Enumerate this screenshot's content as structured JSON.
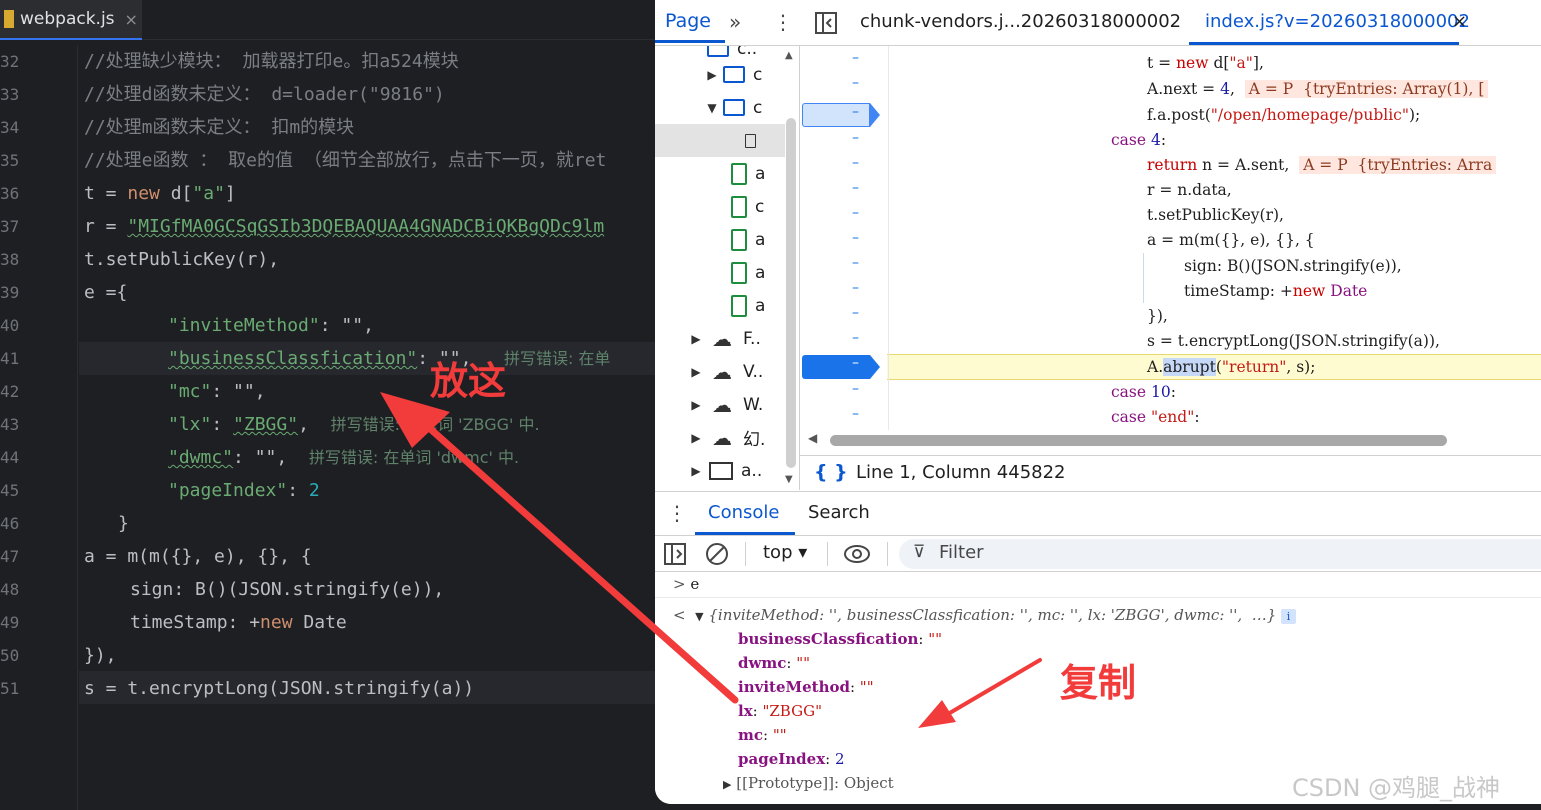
{
  "ide": {
    "tab": {
      "filename": "webpack.js",
      "close": "×"
    },
    "line_numbers": [
      "32",
      "33",
      "34",
      "35",
      "36",
      "37",
      "38",
      "39",
      "40",
      "41",
      "42",
      "43",
      "44",
      "45",
      "46",
      "47",
      "48",
      "49",
      "50",
      "51"
    ],
    "lines": {
      "l32": "//处理缺少模块： 加载器打印e。扣a524模块",
      "l33": "//处理d函数未定义： d=loader(\"9816\")",
      "l34": "//处理m函数未定义： 扣m的模块",
      "l35": "//处理e函数 ： 取e的值 （细节全部放行，点击下一页，就ret",
      "l36_a": "t = ",
      "l36_kw": "new",
      "l36_b": " d[",
      "l36_str": "\"a\"",
      "l36_c": "]",
      "l37_a": "r = ",
      "l37_str": "\"MIGfMA0GCSqGSIb3DQEBAQUAA4GNADCBiQKBgQDc9lm",
      "l38": "t.setPublicKey(r),",
      "l39": "e ={",
      "l40_k": "\"inviteMethod\"",
      "l40_v": ": \"\",",
      "l41_k": "\"businessClassfication\"",
      "l41_v": ": \"\",",
      "l41_hint": "拼写错误: 在单",
      "l42_k": "\"mc\"",
      "l42_v": ": \"\",",
      "l43_k": "\"lx\"",
      "l43_m": ": ",
      "l43_v": "\"ZBGG\"",
      "l43_e": ",",
      "l43_hint": "拼写错误: 在单词 'ZBGG' 中.",
      "l44_k": "\"dwmc\"",
      "l44_v": ": \"\",",
      "l44_hint": "拼写错误: 在单词 'dwmc' 中.",
      "l45_k": "\"pageIndex\"",
      "l45_m": ": ",
      "l45_v": "2",
      "l46": "}",
      "l47": "a = m(m({}, e), {}, {",
      "l48": "sign: B()(JSON.stringify(e)),",
      "l49_a": "timeStamp: +",
      "l49_kw": "new",
      "l49_b": " Date",
      "l50": "}),",
      "l51": "s = t.encryptLong(JSON.stringify(a))"
    }
  },
  "devtools": {
    "page_tab": "Page",
    "more_tabs_icon": "»",
    "menu_icon": "⋮",
    "file_tabs": [
      "chunk-vendors.j...20260318000002",
      "index.js?v=20260318000002"
    ],
    "file_tab_close": "×",
    "navigator": {
      "items": [
        {
          "label": "c..",
          "kind": "folder"
        },
        {
          "label": "c",
          "kind": "folder"
        },
        {
          "label": "c",
          "kind": "folder"
        },
        {
          "label": "",
          "kind": "file-selected"
        },
        {
          "label": "a",
          "kind": "file"
        },
        {
          "label": "c",
          "kind": "file"
        },
        {
          "label": "a",
          "kind": "file"
        },
        {
          "label": "a",
          "kind": "file"
        },
        {
          "label": "a",
          "kind": "file"
        },
        {
          "label": "F..",
          "kind": "cloud"
        },
        {
          "label": "V..",
          "kind": "cloud"
        },
        {
          "label": "W.",
          "kind": "cloud"
        },
        {
          "label": "幻.",
          "kind": "cloud"
        },
        {
          "label": "a..",
          "kind": "frame"
        }
      ]
    },
    "source": {
      "line_marker": "–",
      "l1_a": "t = ",
      "l1_kw": "new",
      "l1_b": " d[",
      "l1_str": "\"a\"",
      "l1_c": "],",
      "l2_a": "A.next = ",
      "l2_num": "4",
      "l2_b": ",",
      "l2_inline": "A = P  {tryEntries: Array(1), [",
      "l3_a": "f.a.post(",
      "l3_str": "\"/open/homepage/public\"",
      "l3_b": ");",
      "l4_kw": "case",
      "l4_num": " 4",
      "l4_b": ":",
      "l5_kw": "return",
      "l5_a": " n = A.sent,",
      "l5_inline": "A = P  {tryEntries: Arra",
      "l6": "r = n.data,",
      "l7": "t.setPublicKey(r),",
      "l8": "a = m(m({}, e), {}, {",
      "l9": "sign: B()(JSON.stringify(e)),",
      "l10_a": "timeStamp: +",
      "l10_kw": "new",
      "l10_b": " Date",
      "l11": "}),",
      "l12": "s = t.encryptLong(JSON.stringify(a)),",
      "l13_a": "A.",
      "l13_sel": "abrupt",
      "l13_b": "(",
      "l13_str": "\"return\"",
      "l13_c": ", s);",
      "l14_kw": "case",
      "l14_num": " 10",
      "l14_b": ":",
      "l15_kw": "case",
      "l15_str": " \"end\"",
      "l15_b": ":"
    },
    "status": {
      "icon": "{ }",
      "text": "Line 1, Column 445822"
    },
    "drawer_tabs": [
      "Console",
      "Search"
    ],
    "console_toolbar": {
      "context": "top ▾",
      "filter": "Filter"
    },
    "console": {
      "input_prompt": ">",
      "input": "e",
      "output_prompt": "<",
      "summary": "{inviteMethod: '', businessClassfication: '', mc: '', lx: 'ZBGG', dwmc: '',  …}",
      "info": "i",
      "props": [
        {
          "key": "businessClassfication",
          "value": "\"\"",
          "type": "str"
        },
        {
          "key": "dwmc",
          "value": "\"\"",
          "type": "str"
        },
        {
          "key": "inviteMethod",
          "value": "\"\"",
          "type": "str"
        },
        {
          "key": "lx",
          "value": "\"ZBGG\"",
          "type": "str"
        },
        {
          "key": "mc",
          "value": "\"\"",
          "type": "str"
        },
        {
          "key": "pageIndex",
          "value": "2",
          "type": "num"
        }
      ],
      "prototype": "[[Prototype]]: Object"
    }
  },
  "annotations": {
    "put_here": "放这",
    "copy": "复制",
    "color": "#f23b3b",
    "watermark": "CSDN @鸡腿_战神"
  }
}
